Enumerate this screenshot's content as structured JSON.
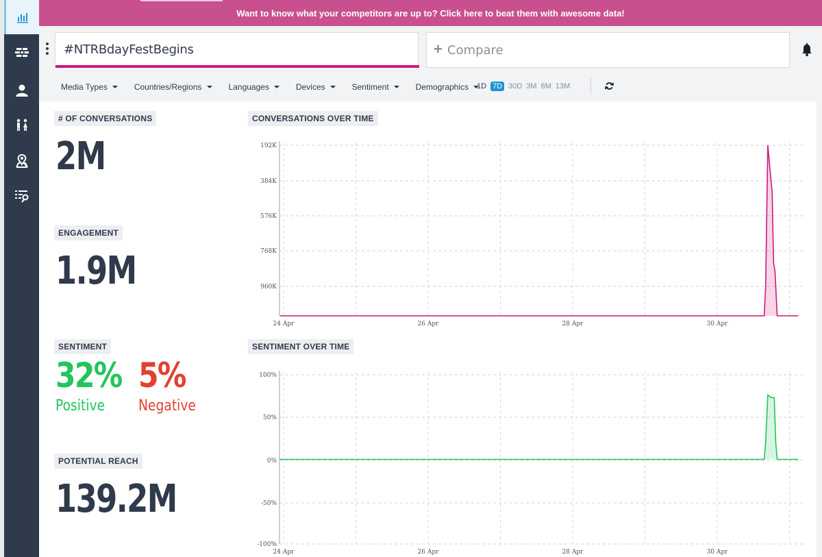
{
  "banner": {
    "text": "Want to know what your competitors are up to? Click here to beat them with awesome data!"
  },
  "sidebar": {
    "items": [
      {
        "icon": "bar-chart-icon"
      },
      {
        "icon": "brick-wall-icon"
      },
      {
        "icon": "user-icon"
      },
      {
        "icon": "people-icon"
      },
      {
        "icon": "map-pin-icon"
      },
      {
        "icon": "list-search-icon"
      }
    ]
  },
  "search": {
    "query": "#NTRBdayFestBegins",
    "compare_label": "Compare"
  },
  "filters": [
    "Media Types",
    "Countries/Regions",
    "Languages",
    "Devices",
    "Sentiment",
    "Demographics"
  ],
  "ranges": {
    "items": [
      "1D",
      "7D",
      "30D",
      "3M",
      "6M",
      "13M"
    ],
    "selected": "7D"
  },
  "metrics": {
    "conversations": {
      "label": "# OF CONVERSATIONS",
      "value": "2M"
    },
    "engagement": {
      "label": "ENGAGEMENT",
      "value": "1.9M"
    },
    "sentiment": {
      "label": "SENTIMENT",
      "positive_value": "32%",
      "positive_label": "Positive",
      "negative_value": "5%",
      "negative_label": "Negative"
    },
    "reach": {
      "label": "POTENTIAL REACH",
      "value": "139.2M"
    }
  },
  "colors": {
    "accent": "#d0177a",
    "positive": "#22c55e",
    "negative": "#e3412f",
    "banner": "#c9508f",
    "sidebar": "#2f3b4c"
  },
  "chart_data": [
    {
      "type": "area",
      "title": "CONVERSATIONS OVER TIME",
      "x_ticks": [
        "24 Apr",
        "26 Apr",
        "28 Apr",
        "30 Apr"
      ],
      "y_ticks": [
        "192K",
        "384K",
        "576K",
        "768K",
        "960K"
      ],
      "ylim": [
        0,
        960000
      ],
      "grid": true,
      "color": "#d0177a",
      "series": [
        {
          "x": [
            -0.05,
            6.65,
            6.67,
            6.7,
            6.74,
            6.76,
            6.78,
            6.8,
            6.83,
            6.9,
            7.12
          ],
          "y": [
            0,
            0,
            160000,
            960000,
            780000,
            700000,
            300000,
            250000,
            0,
            0,
            0
          ]
        }
      ]
    },
    {
      "type": "area",
      "title": "SENTIMENT OVER TIME",
      "x_ticks": [
        "24 Apr",
        "26 Apr",
        "28 Apr",
        "30 Apr"
      ],
      "y_ticks": [
        "100%",
        "50%",
        "0%",
        "-50%",
        "-100%"
      ],
      "ylim": [
        -100,
        100
      ],
      "grid": true,
      "color": "#22c55e",
      "series": [
        {
          "x": [
            -0.05,
            6.65,
            6.67,
            6.7,
            6.75,
            6.79,
            6.81,
            6.83,
            6.9,
            7.12
          ],
          "y": [
            0,
            0,
            20,
            76,
            73,
            73,
            20,
            0,
            0,
            0
          ]
        }
      ]
    }
  ]
}
